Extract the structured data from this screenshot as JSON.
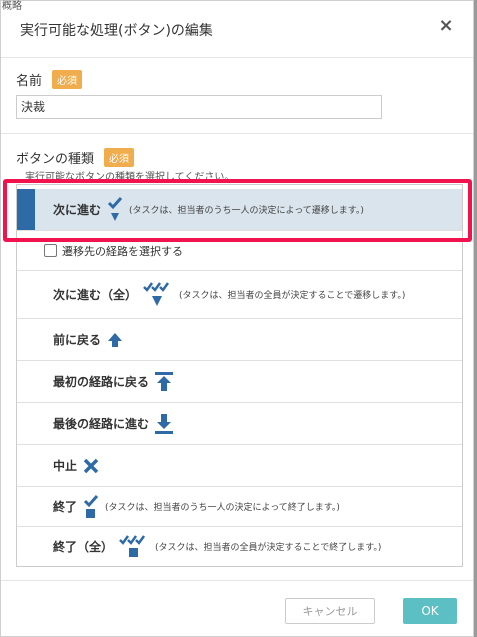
{
  "dialog": {
    "title": "実行可能な処理(ボタン)の編集",
    "close_label": "×"
  },
  "name_field": {
    "label": "名前",
    "required_badge": "必須",
    "value": "決裁"
  },
  "button_type": {
    "label": "ボタンの種類",
    "required_badge": "必須",
    "hint": "実行可能なボタンの種類を選択してください。"
  },
  "options": [
    {
      "label": "次に進む",
      "icon": "check-arrow-down-icon",
      "desc": "(タスクは、担当者のうち一人の決定によって遷移します。)",
      "selected": true
    },
    {
      "label": "次に進む（全）",
      "icon": "multi-check-arrow-down-icon",
      "desc": "(タスクは、担当者の全員が決定することで遷移します。)"
    },
    {
      "label": "前に戻る",
      "icon": "arrow-up-icon",
      "desc": ""
    },
    {
      "label": "最初の経路に戻る",
      "icon": "arrow-up-to-line-icon",
      "desc": ""
    },
    {
      "label": "最後の経路に進む",
      "icon": "arrow-down-to-line-icon",
      "desc": ""
    },
    {
      "label": "中止",
      "icon": "x-icon",
      "desc": ""
    },
    {
      "label": "終了",
      "icon": "check-square-icon",
      "desc": "(タスクは、担当者のうち一人の決定によって終了します。)"
    },
    {
      "label": "終了（全）",
      "icon": "multi-check-square-icon",
      "desc": "(タスクは、担当者の全員が決定することで終了します。)"
    }
  ],
  "route_checkbox": {
    "label": "遷移先の経路を選択する",
    "checked": false
  },
  "footer": {
    "cancel_label": "キャンセル",
    "ok_label": "OK"
  },
  "colors": {
    "accent": "#2e6aa5",
    "selected_bg": "#dae4ed",
    "badge": "#f0ad4e",
    "ok_button": "#5bbfc4",
    "highlight": "#f0134e"
  },
  "backdrop": {
    "corner_text": "概略"
  }
}
